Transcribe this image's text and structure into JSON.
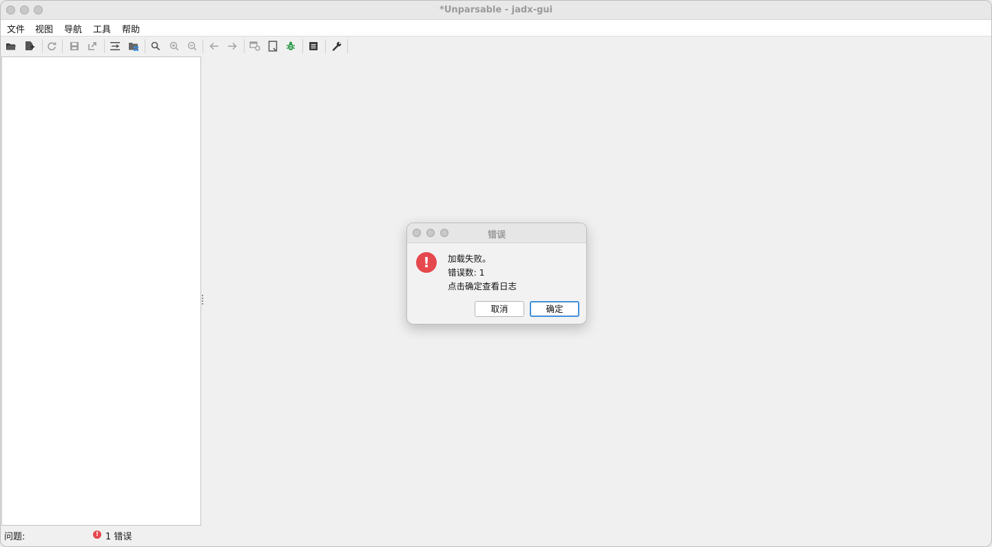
{
  "window": {
    "title": "*Unparsable - jadx-gui"
  },
  "menu": {
    "items": [
      {
        "label": "文件"
      },
      {
        "label": "视图"
      },
      {
        "label": "导航"
      },
      {
        "label": "工具"
      },
      {
        "label": "帮助"
      }
    ]
  },
  "toolbar": {
    "icons": [
      "open-folder-icon",
      "add-files-icon",
      "reload-icon",
      "save-icon",
      "export-icon",
      "sync-tree-icon",
      "flatten-packages-icon",
      "search-icon",
      "find-usage-icon",
      "find-text-icon",
      "back-icon",
      "forward-icon",
      "deobfuscation-icon",
      "bookmark-icon",
      "debugger-icon",
      "log-icon",
      "preferences-icon"
    ]
  },
  "statusbar": {
    "issues_label": "问题:",
    "error_count": "1 错误"
  },
  "dialog": {
    "title": "错误",
    "line1": "加载失败。",
    "line2": "错误数: 1",
    "line3": "点击确定查看日志",
    "cancel_label": "取消",
    "ok_label": "确定",
    "alert_symbol": "!"
  },
  "colors": {
    "error_red": "#e5484d",
    "default_button_border": "#3d8fd9",
    "debugger_green": "#2e9c4b"
  }
}
